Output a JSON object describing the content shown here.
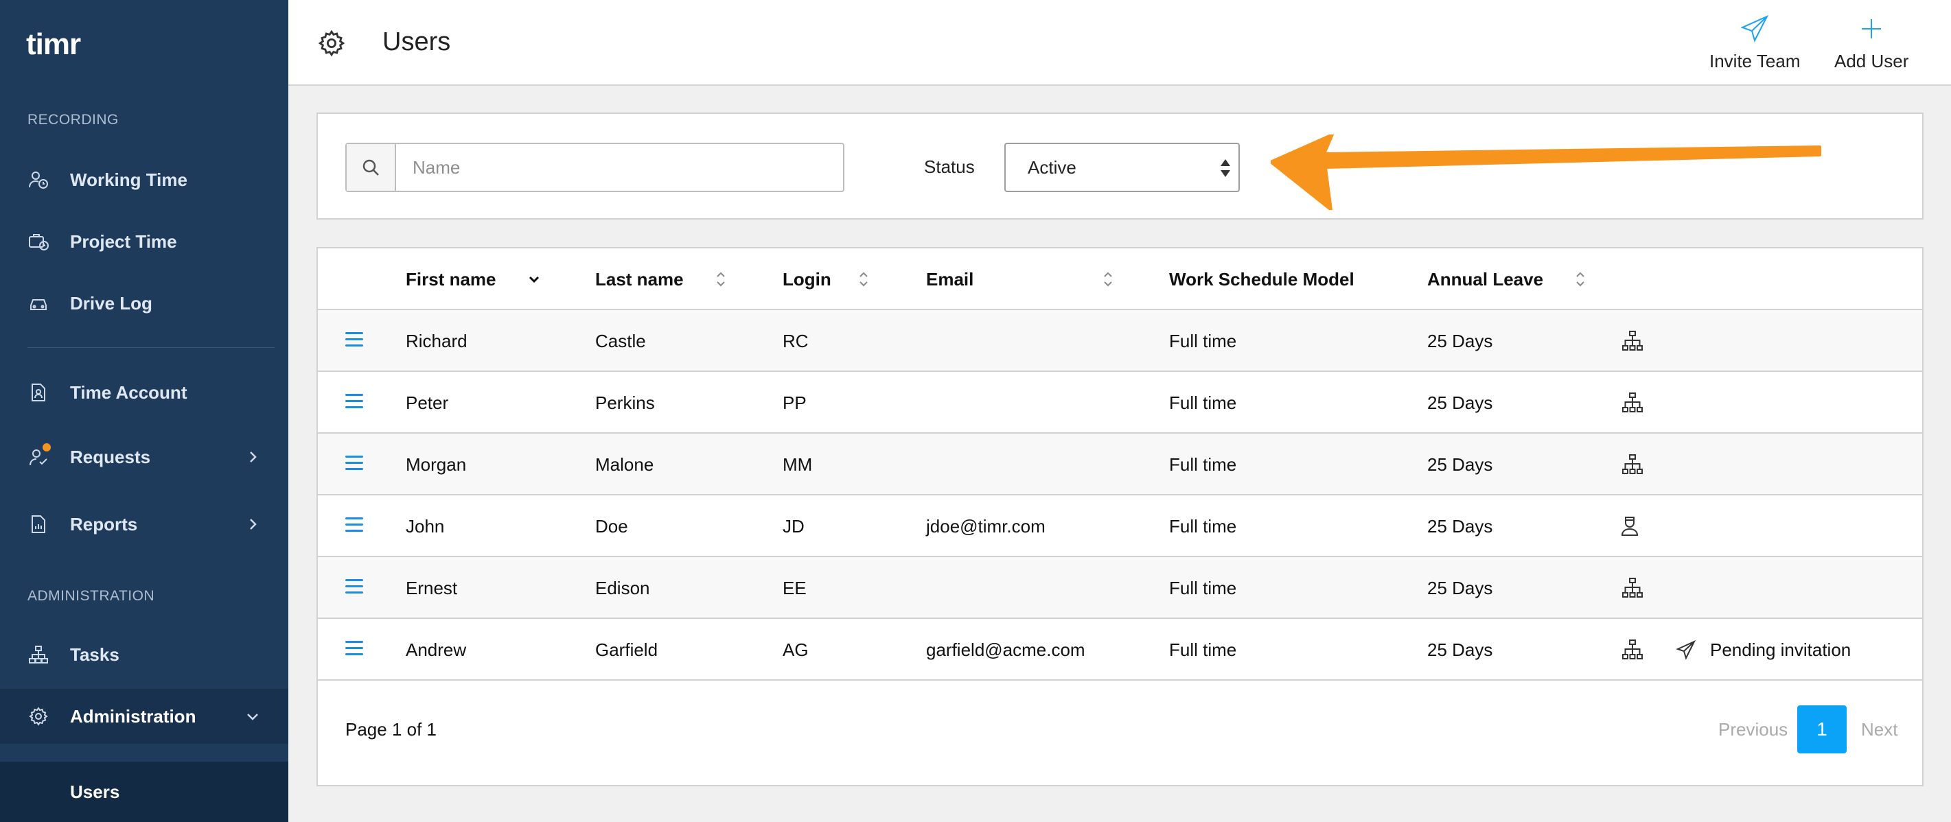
{
  "app": {
    "logo_text": "timr"
  },
  "sidebar": {
    "section_recording": "RECORDING",
    "section_administration": "ADMINISTRATION",
    "items": [
      {
        "label": "Working Time",
        "icon": "user-clock-icon"
      },
      {
        "label": "Project Time",
        "icon": "briefcase-clock-icon"
      },
      {
        "label": "Drive Log",
        "icon": "car-icon"
      },
      {
        "label": "Time Account",
        "icon": "document-person-icon"
      },
      {
        "label": "Requests",
        "icon": "user-check-icon"
      },
      {
        "label": "Reports",
        "icon": "document-chart-icon"
      },
      {
        "label": "Tasks",
        "icon": "hierarchy-icon"
      },
      {
        "label": "Administration",
        "icon": "gear-icon"
      }
    ],
    "sub_item": "Users",
    "badge_color": "#f39422"
  },
  "header": {
    "title": "Users",
    "invite_label": "Invite Team",
    "add_label": "Add User"
  },
  "filter": {
    "search_placeholder": "Name",
    "search_value": "",
    "status_label": "Status",
    "status_value": "Active"
  },
  "table": {
    "columns": [
      "First name",
      "Last name",
      "Login",
      "Email",
      "Work Schedule Model",
      "Annual Leave"
    ],
    "rows": [
      {
        "first": "Richard",
        "last": "Castle",
        "login": "RC",
        "email": "",
        "schedule": "Full time",
        "leave": "25 Days",
        "icon": "hierarchy-icon",
        "status": ""
      },
      {
        "first": "Peter",
        "last": "Perkins",
        "login": "PP",
        "email": "",
        "schedule": "Full time",
        "leave": "25 Days",
        "icon": "hierarchy-icon",
        "status": ""
      },
      {
        "first": "Morgan",
        "last": "Malone",
        "login": "MM",
        "email": "",
        "schedule": "Full time",
        "leave": "25 Days",
        "icon": "hierarchy-icon",
        "status": ""
      },
      {
        "first": "John",
        "last": "Doe",
        "login": "JD",
        "email": "jdoe@timr.com",
        "schedule": "Full time",
        "leave": "25 Days",
        "icon": "user-badge-icon",
        "status": ""
      },
      {
        "first": "Ernest",
        "last": "Edison",
        "login": "EE",
        "email": "",
        "schedule": "Full time",
        "leave": "25 Days",
        "icon": "hierarchy-icon",
        "status": ""
      },
      {
        "first": "Andrew",
        "last": "Garfield",
        "login": "AG",
        "email": "garfield@acme.com",
        "schedule": "Full time",
        "leave": "25 Days",
        "icon": "hierarchy-icon",
        "status": "Pending invitation"
      }
    ]
  },
  "pagination": {
    "info": "Page 1 of 1",
    "previous": "Previous",
    "current": "1",
    "next": "Next"
  },
  "colors": {
    "sidebar": "#1f3b5c",
    "accent": "#0aa3f7",
    "annotation_arrow": "#f7941d"
  }
}
